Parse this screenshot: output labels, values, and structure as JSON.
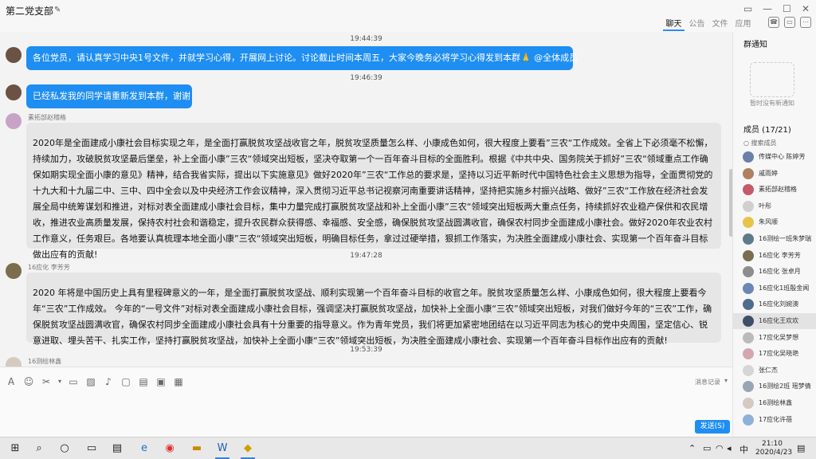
{
  "window": {
    "title": "第二党支部",
    "tabs": [
      "聊天",
      "公告",
      "文件",
      "应用"
    ]
  },
  "messages": [
    {
      "time": "19:44:39"
    },
    {
      "text": "各位党员，请认真学习中央1号文件，并就学习心得，开展网上讨论。讨论截止时间本周五，大家今晚务必将学习心得发到本群🙏 @全体成员"
    },
    {
      "time": "19:46:39"
    },
    {
      "text": "已经私发我的同学请重新发到本群，谢谢"
    },
    {
      "sender": "素拓部赵稽格",
      "text": "2020年是全面建成小康社会目标实现之年，是全面打赢脱贫攻坚战收官之年，脱贫攻坚质量怎么样、小康成色如何，很大程度上要看”三农“工作成效。全省上下必须毫不松懈，持续加力，攻破脱贫攻坚最后堡垒，补上全面小康”三农“领域突出短板，坚决夺取第一个一百年奋斗目标的全面胜利。根据《中共中央、国务院关于抓好”三农“领域重点工作确保如期实现全面小康的意见》精神，结合我省实际，提出以下实施意见》做好2020年”三农“工作总的要求是，坚持以习近平新时代中国特色社会主义思想为指导，全面贯彻党的十九大和十九届二中、三中、四中全会以及中央经济工作会议精神，深入贯彻习近平总书记视察河南重要讲话精神，坚持把实施乡村振兴战略、做好”三农“工作放在经济社会发展全局中统筹谋划和推进，对标对表全面建成小康社会目标，集中力量完成打赢脱贫攻坚战和补上全面小康”三农“领域突出短板两大重点任务，持续抓好农业稳产保供和农民增收，推进农业高质量发展，保持农村社会和谐稳定，提升农民群众获得感、幸福感、安全感，确保脱贫攻坚战圆满收官，确保农村同步全面建成小康社会。做好2020年农业农村工作意义，任务艰巨。各地要认真梳理本地全面小康”三农“领域突出短板，明确目标任务，拿过过硬举措，狠抓工作落实，为决胜全面建成小康社会、实现第一个百年奋斗目标做出应有的贡献!"
    },
    {
      "time": "19:47:28"
    },
    {
      "sender": "16应化 李芳芳",
      "text": "2020 年将是中国历史上具有里程碑意义的一年，是全面打赢脱贫攻坚战、顺利实现第一个百年奋斗目标的收官之年。脱贫攻坚质量怎么样、小康成色如何，很大程度上要看今年“三农”工作成效。 今年的“一号文件”对标对表全面建成小康社会目标，强调坚决打赢脱贫攻坚战，加快补上全面小康“三农”领域突出短板，对我们做好今年的“三农”工作，确保脱贫攻坚战圆满收官，确保农村同步全面建成小康社会具有十分重要的指导意义。作为青年党员，我们将更加紧密地团结在以习近平同志为核心的党中央周围，坚定信心、锐意进取、埋头苦干、扎实工作，坚持打赢脱贫攻坚战，加快补上全面小康“三农”领域突出短板，为决胜全面建成小康社会、实现第一个百年奋斗目标作出应有的贡献!"
    },
    {
      "time": "19:53:39"
    },
    {
      "sender": "16测绘林鑫"
    }
  ],
  "input": {
    "history_label": "消息记录",
    "send_label": "发送(S)"
  },
  "right_panel": {
    "notice_title": "群通知",
    "notice_empty": "暂时没有新通知",
    "members_title": "成员 (17/21)",
    "search_placeholder": "搜索成员",
    "members": [
      "传媒中心 陈婷芳",
      "戚雨婷",
      "素拓部赵稽格",
      "叶彤",
      "朱风顺",
      "16测绘一班朱梦瑞",
      "16应化 李芳芳",
      "16应化 张卓月",
      "16应化1班殷金闻",
      "16应化刘婉澳",
      "16应化王欢欢",
      "17应化吴梦想",
      "17应化吴晓艳",
      "张仁杰",
      "16测绘2班 瑶梦倩",
      "16测绘林鑫",
      "17应化许蓓"
    ]
  },
  "taskbar": {
    "time": "21:10",
    "date": "2020/4/23",
    "ime": "中"
  }
}
